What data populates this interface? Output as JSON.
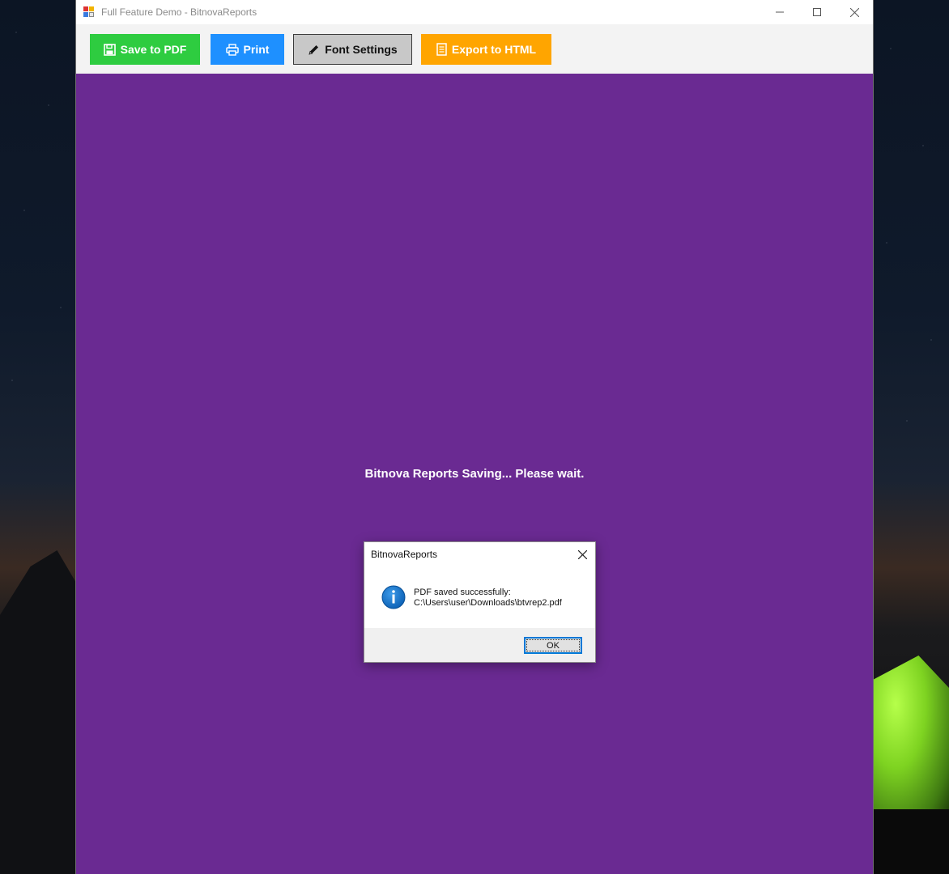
{
  "window": {
    "title": "Full Feature Demo - BitnovaReports",
    "controls": [
      "minimize-icon",
      "maximize-icon",
      "close-icon"
    ]
  },
  "toolbar": {
    "save_label": "Save to PDF",
    "save_icon": "floppy-disk-icon",
    "save_color": "#2ecc40",
    "print_label": "Print",
    "print_icon": "printer-icon",
    "print_color": "#1e90ff",
    "font_label": "Font Settings",
    "font_icon": "pencil-icon",
    "font_color": "#c8c8c8",
    "export_label": "Export to HTML",
    "export_icon": "document-icon",
    "export_color": "#ffa500"
  },
  "content": {
    "background": "#6a2a92",
    "status_text": "Bitnova Reports Saving... Please wait."
  },
  "dialog": {
    "title": "BitnovaReports",
    "icon": "info-icon",
    "message_line1": "PDF saved successfully:",
    "message_line2": "C:\\Users\\user\\Downloads\\btvrep2.pdf",
    "ok_label": "OK",
    "accent": "#0078d7"
  }
}
